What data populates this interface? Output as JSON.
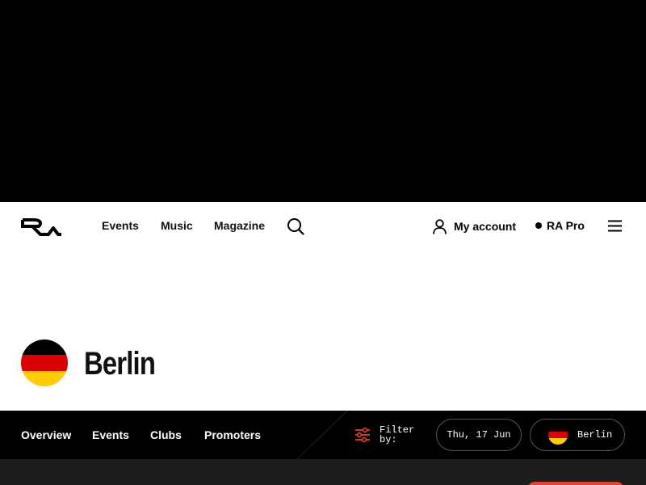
{
  "header": {
    "logo_alt": "RA",
    "nav": [
      "Events",
      "Music",
      "Magazine"
    ],
    "account_label": "My account",
    "pro_label": "RA Pro"
  },
  "city": {
    "name": "Berlin",
    "flag_colors": [
      "#000000",
      "#dd0000",
      "#ffce00"
    ]
  },
  "subnav": {
    "items": [
      "Overview",
      "Events",
      "Clubs",
      "Promoters"
    ],
    "filter_label": "Filter by:",
    "date_value": "Thu, 17 Jun",
    "city_value": "Berlin"
  },
  "colors": {
    "accent": "#e1452f",
    "dark": "#000000"
  }
}
